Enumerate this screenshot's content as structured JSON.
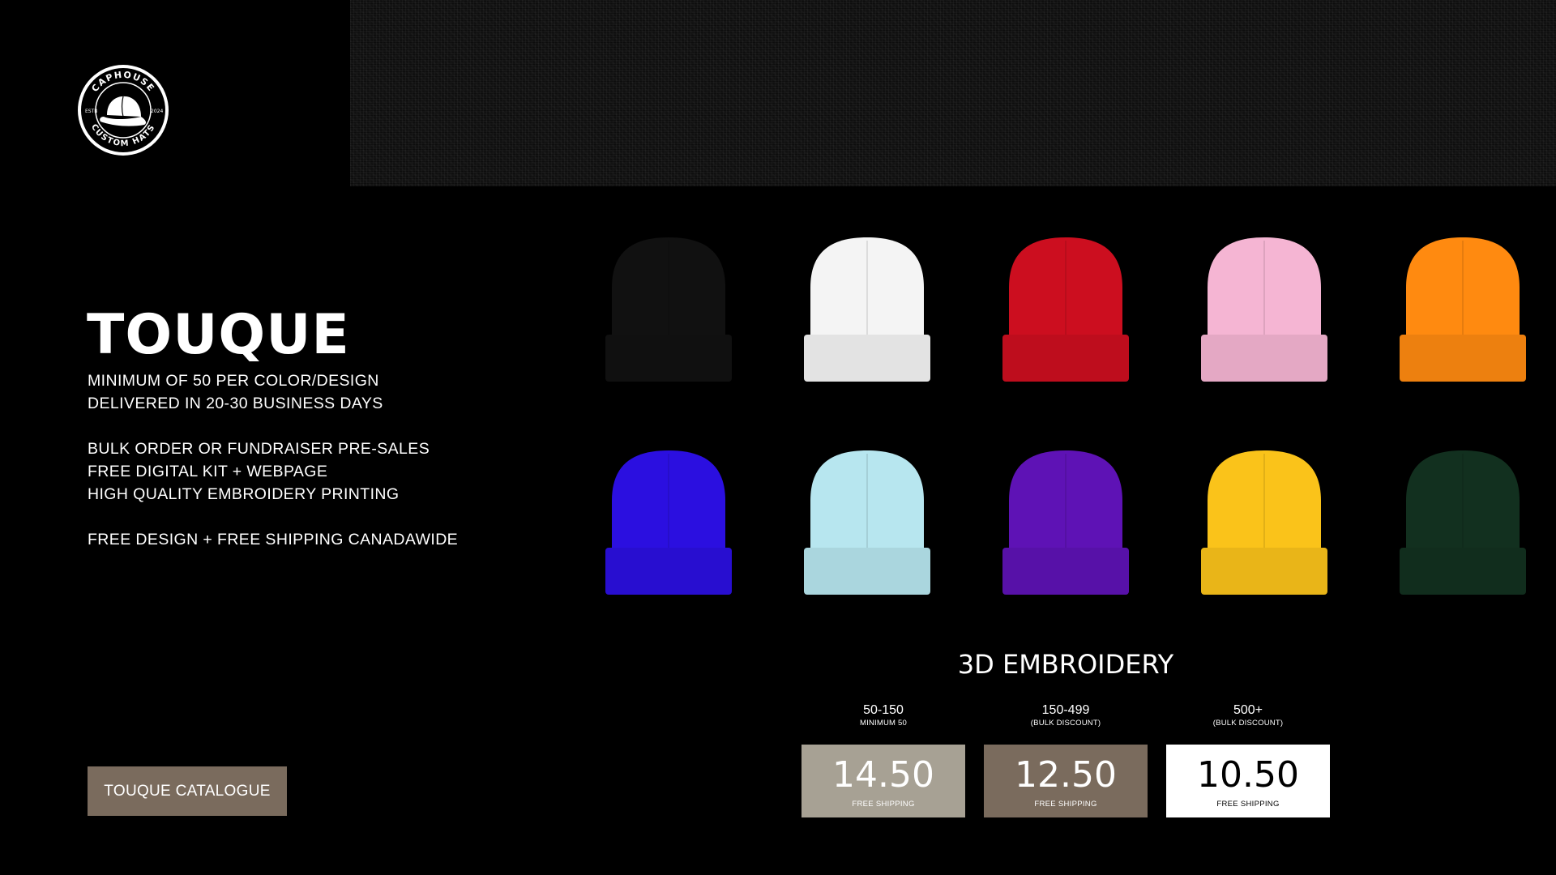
{
  "header": {
    "texture_color": "#151515"
  },
  "logo": {
    "top_text": "CAPHOUSE",
    "bottom_text": "CUSTOM HATS",
    "left_text": "ESTB",
    "right_text": "2024",
    "icon": "baseball-cap-icon"
  },
  "product": {
    "title": "TOUQUE",
    "info_lines": [
      "MINIMUM OF 50 PER COLOR/DESIGN",
      "DELIVERED IN 20-30 BUSINESS DAYS",
      "BULK ORDER OR FUNDRAISER PRE-SALES",
      "FREE DIGITAL KIT + WEBPAGE",
      "HIGH QUALITY EMBROIDERY PRINTING",
      "FREE  DESIGN + FREE SHIPPING CANADAWIDE"
    ]
  },
  "catalogue_button": {
    "label": "TOUQUE CATALOGUE",
    "color": "#7a6b5d"
  },
  "colors": {
    "row1": [
      "#111111",
      "#f4f4f4",
      "#cc0e1f",
      "#f5b5d3",
      "#ff8a10"
    ],
    "row2": [
      "#2b0fe0",
      "#b7e6ef",
      "#5e12b5",
      "#fac31a",
      "#12301f"
    ]
  },
  "pricing": {
    "section_title": "3D EMBROIDERY",
    "tiers": [
      {
        "range": "50-150",
        "note": "MINIMUM 50",
        "price": "14.50",
        "price_note": "FREE SHIPPING",
        "bg": "#a7a194",
        "fg": "#ffffff"
      },
      {
        "range": "150-499",
        "note": "(BULK DISCOUNT)",
        "price": "12.50",
        "price_note": "FREE SHIPPING",
        "bg": "#7a6b5d",
        "fg": "#ffffff"
      },
      {
        "range": "500+",
        "note": "(BULK DISCOUNT)",
        "price": "10.50",
        "price_note": "FREE SHIPPING",
        "bg": "#ffffff",
        "fg": "#000000"
      }
    ]
  }
}
